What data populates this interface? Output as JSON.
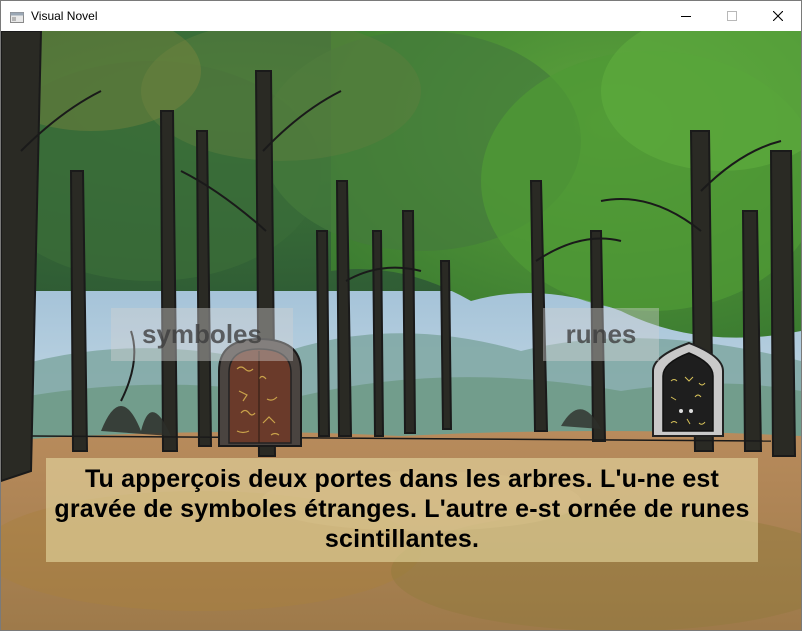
{
  "window": {
    "title": "Visual Novel"
  },
  "choices": [
    {
      "label": "symboles"
    },
    {
      "label": "runes"
    }
  ],
  "dialogue": {
    "text": "Tu apperçois deux portes dans les arbres. L'u-ne est gravée de symboles étranges. L'autre e-st ornée de runes scintillantes."
  },
  "icons": {
    "app": "app-window-icon",
    "minimize": "minimize-icon",
    "maximize": "maximize-icon",
    "close": "close-icon"
  },
  "colors": {
    "sky": "#a8c8e4",
    "foliage": "#4f8a3a",
    "ground": "#b08a5a",
    "dialogue_bg": "#e8dca5",
    "choice_bg": "#d2d2d2"
  }
}
